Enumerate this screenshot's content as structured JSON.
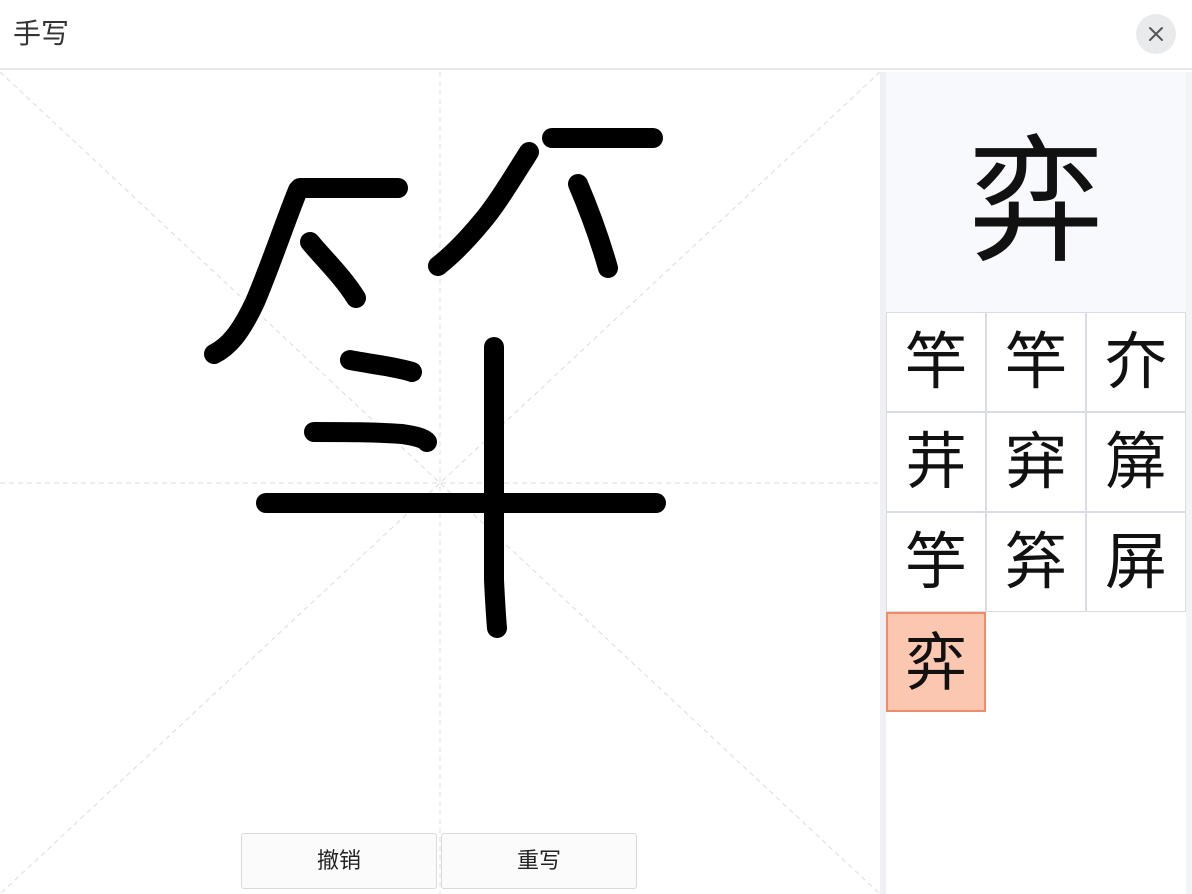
{
  "header": {
    "title": "手写",
    "close_icon": "close-icon"
  },
  "canvas": {
    "undo_label": "撤销",
    "rewrite_label": "重写",
    "ink_color": "#000000",
    "guide_color": "#d9d9d9"
  },
  "preview": {
    "char": "弈"
  },
  "candidates": [
    "竿",
    "竿",
    "夰",
    "茾",
    "穽",
    "箳",
    "竽",
    "笲",
    "屏",
    "弈"
  ],
  "selected_index": 9,
  "colors": {
    "selected_bg": "#fcc7b1",
    "selected_border": "#ee8c6a",
    "panel_bg": "#f7f9fc"
  }
}
